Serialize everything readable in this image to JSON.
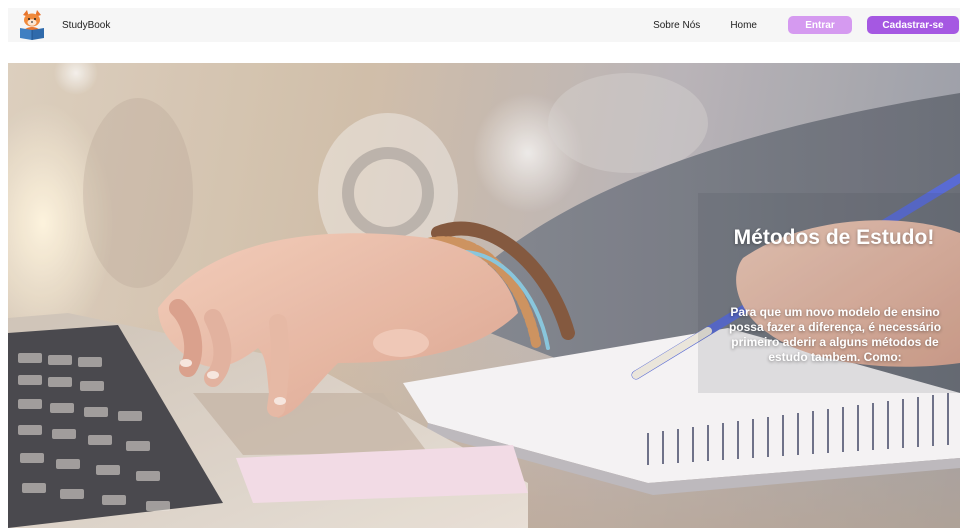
{
  "navbar": {
    "logo_icon": "fox-reading-book-icon",
    "brand_name": "StudyBook",
    "links": {
      "sobre": "Sobre Nós",
      "home": "Home"
    },
    "buttons": {
      "entrar": "Entrar",
      "cadastrar": "Cadastrar-se"
    }
  },
  "hero": {
    "image_icon": "hands-laptop-notebook-photo",
    "title": "Métodos de Estudo!",
    "text": "Para que um novo modelo de ensino possa fazer a diferença, é necessário primeiro aderir a alguns métodos de estudo tambem. Como:"
  },
  "colors": {
    "entrar_button": "#d59af0",
    "cadastrar_button": "#a558e2",
    "navbar_background": "#f6f6f6"
  }
}
